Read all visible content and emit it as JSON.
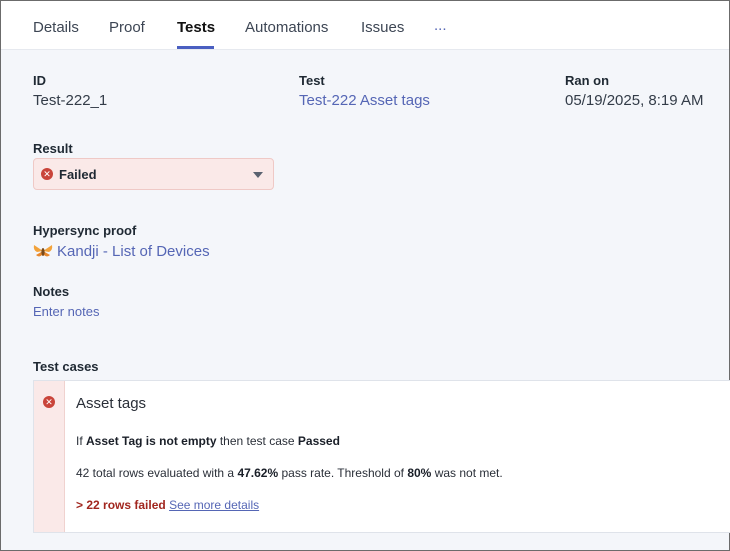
{
  "tabs": [
    {
      "label": "Details"
    },
    {
      "label": "Proof"
    },
    {
      "label": "Tests"
    },
    {
      "label": "Automations"
    },
    {
      "label": "Issues"
    },
    {
      "label": "..."
    }
  ],
  "active_tab": "Tests",
  "fields": {
    "id_label": "ID",
    "id_value": "Test-222_1",
    "test_label": "Test",
    "test_value": "Test-222 Asset tags",
    "ran_on_label": "Ran on",
    "ran_on_value": "05/19/2025, 8:19 AM"
  },
  "result": {
    "label": "Result",
    "value": "Failed",
    "status_color": "#c9443a"
  },
  "hypersync": {
    "label": "Hypersync proof",
    "link": "Kandji - List of Devices",
    "icon": "kandji-bee-icon"
  },
  "notes": {
    "label": "Notes",
    "placeholder": "Enter notes"
  },
  "test_cases": {
    "label": "Test cases",
    "items": [
      {
        "title": "Asset tags",
        "rule_prefix": "If ",
        "rule_condition": "Asset Tag is not empty",
        "rule_middle": " then test case ",
        "rule_outcome": "Passed",
        "summary_prefix": "42 total rows evaluated with a ",
        "pass_rate": "47.62%",
        "summary_middle": " pass rate. Threshold of ",
        "threshold": "80%",
        "summary_suffix": " was not met.",
        "failed_rows": "> 22 rows failed",
        "details_link": "See more details"
      }
    ]
  }
}
